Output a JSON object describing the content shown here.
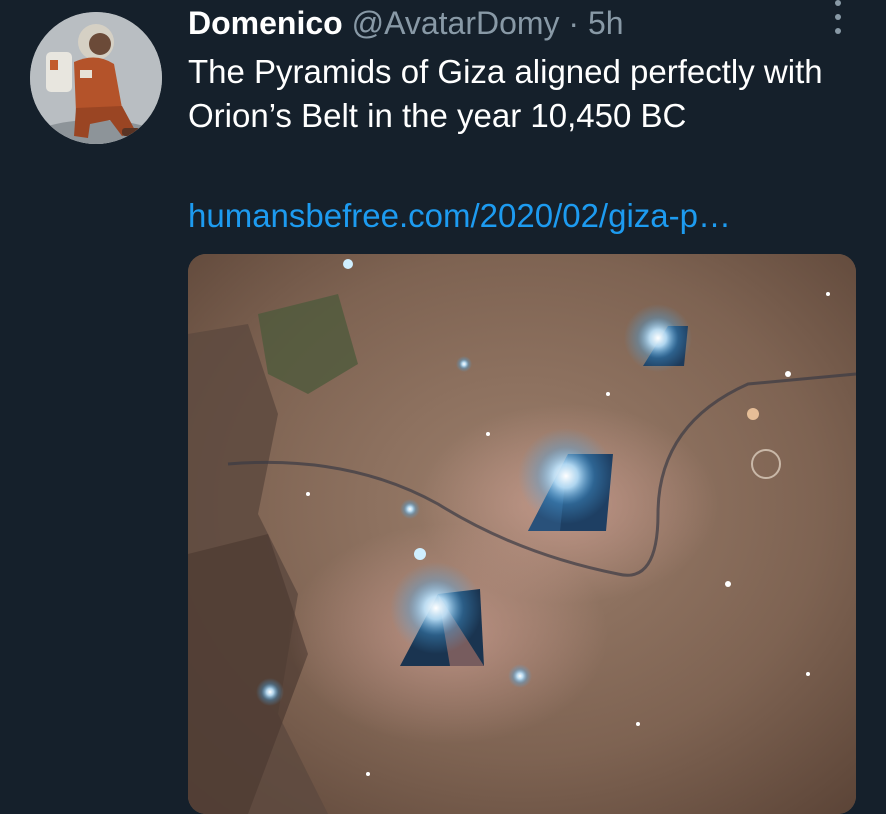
{
  "tweet": {
    "display_name": "Domenico",
    "handle": "@AvatarDomy",
    "separator": "·",
    "time": "5h",
    "text": "The Pyramids of Giza aligned perfectly with Orion’s Belt in the year 10,450 BC",
    "link": "humansbefree.com/2020/02/giza-p…"
  },
  "icons": {
    "more": "more-vertical-icon",
    "avatar": "astronaut-avatar"
  },
  "colors": {
    "background": "#15202b",
    "text": "#ffffff",
    "secondary": "#8899a6",
    "link": "#1d9bf0"
  }
}
